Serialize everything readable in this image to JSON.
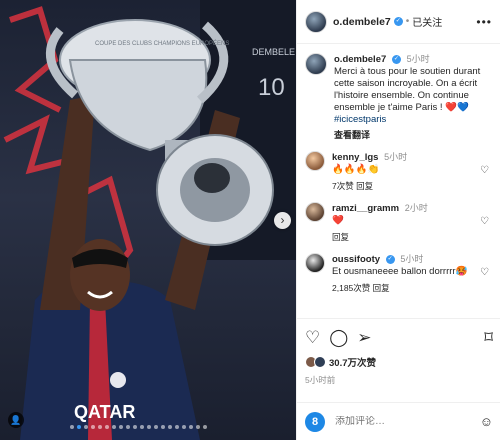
{
  "post": {
    "username": "o.dembele7",
    "follow_status": "已关注",
    "more_icon": "more-dots-icon"
  },
  "caption": {
    "username": "o.dembele7",
    "time": "5小时",
    "text": "Merci à tous pour le soutien durant cette saison incroyable. On a écrit l'histoire ensemble. On continue ensemble je t'aime Paris ! ❤️💙",
    "hashtag": "#icicestparis",
    "translate": "查看翻译"
  },
  "comments": [
    {
      "username": "kenny_lgs",
      "time": "5小时",
      "text": "🔥🔥🔥👏",
      "reply_info": "7次赞  回复"
    },
    {
      "username": "ramzi__gramm",
      "time": "2小时",
      "text": "❤️",
      "reply_info": "回复"
    },
    {
      "username": "oussifooty",
      "time": "5小时",
      "text": "Et ousmaneeee ballon dorrrrr🥵",
      "reply_info": "2,185次赞  回复"
    }
  ],
  "engagement": {
    "likes": "30.7万次赞",
    "post_time": "5小时前"
  },
  "composer": {
    "placeholder": "添加评论…"
  },
  "image": {
    "jersey_number": "10",
    "jersey_name": "DEMBELE",
    "jersey_sponsor": "QATAR",
    "trophy_text": "COUPE DES CLUBS CHAMPIONS EUROPÉENS"
  },
  "colors": {
    "accent_blue": "#3897f0",
    "link_blue": "#00376b",
    "muted": "#8e8e8e",
    "heart_red": "#ed4956"
  }
}
